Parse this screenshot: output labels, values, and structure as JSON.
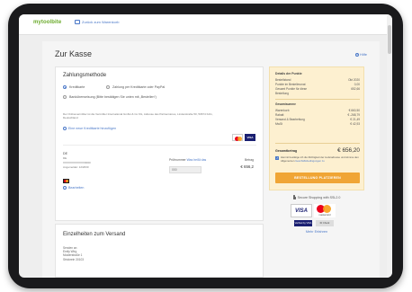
{
  "topbar": {
    "logo": "mytoolbite",
    "cart_link": "Zurück zum Warenkorb"
  },
  "page": {
    "title": "Zur Kasse",
    "help": "Hilfe"
  },
  "payment": {
    "title": "Zahlungsmethode",
    "options": [
      "Kreditkarte",
      "Zahlung per Kreditkarte oder PayPal",
      "Banküberweisung (Bitte bestätigen Sie unten mit „Bestellen“)"
    ],
    "disclaimer": "Der Onlinevermittler ist die Vermittler International GmbH & Co KG, Adresse des Partnerstores, Lindenstraße 50, 50674 Köln, Deutschland",
    "add_card": "Eine neue Kreditkarte hinzufügen",
    "card": {
      "country": "DE",
      "line2": "DE",
      "number": "XXXXXXXXXXXX0000",
      "expiry": "Angemeldet: 12/2030",
      "cvc_label": "Prüfnummer",
      "cvc_link": "Was heißt das",
      "cvc_value": "000",
      "amount_label": "Betrag",
      "amount": "€ 656,2"
    },
    "edit": "Bearbeiten"
  },
  "shipping": {
    "title": "Einzelheiten zum Versand",
    "label": "Senden an",
    "lines": [
      "Emily Wirg",
      "Musterstraße 1",
      "Strickrein 30103"
    ]
  },
  "summary": {
    "title": "Details der Punkte",
    "rows1": [
      {
        "k": "Bestellstand",
        "v": "Okt 2020"
      },
      {
        "k": "Punkte im Bestellmonat",
        "v": "0,00"
      },
      {
        "k": "Gesamt Punkte für diese",
        "v": "652,66"
      },
      {
        "k": "Bestellung",
        "v": ""
      }
    ],
    "sub": "Gesamtsumme",
    "rows2": [
      {
        "k": "Warenkorb",
        "v": "€ 660,50"
      },
      {
        "k": "Rabatt",
        "v": "€ -268,79"
      },
      {
        "k": "Versand & Bearbeitung",
        "v": "€ 21,49"
      },
      {
        "k": "MwSt",
        "v": "€ 42,93"
      }
    ],
    "total_label": "Gesamtbetrag",
    "total": "€ 656,20",
    "agree_text": "Hiermit bestätige ich die Richtigkeit der Lieferadresse und stimme den Allgemeinen",
    "agree_link": "Geschäftsbedingungen zu",
    "place_order": "BESTELLUNG PLATZIEREN"
  },
  "secure": {
    "text": "Secure Shopping with SSL2.0",
    "visa": "VISA",
    "mc_label": "mastercard",
    "badge1": "Verified by VISA",
    "badge2": "ID Check",
    "more_info": "Mehr Erfahren"
  }
}
